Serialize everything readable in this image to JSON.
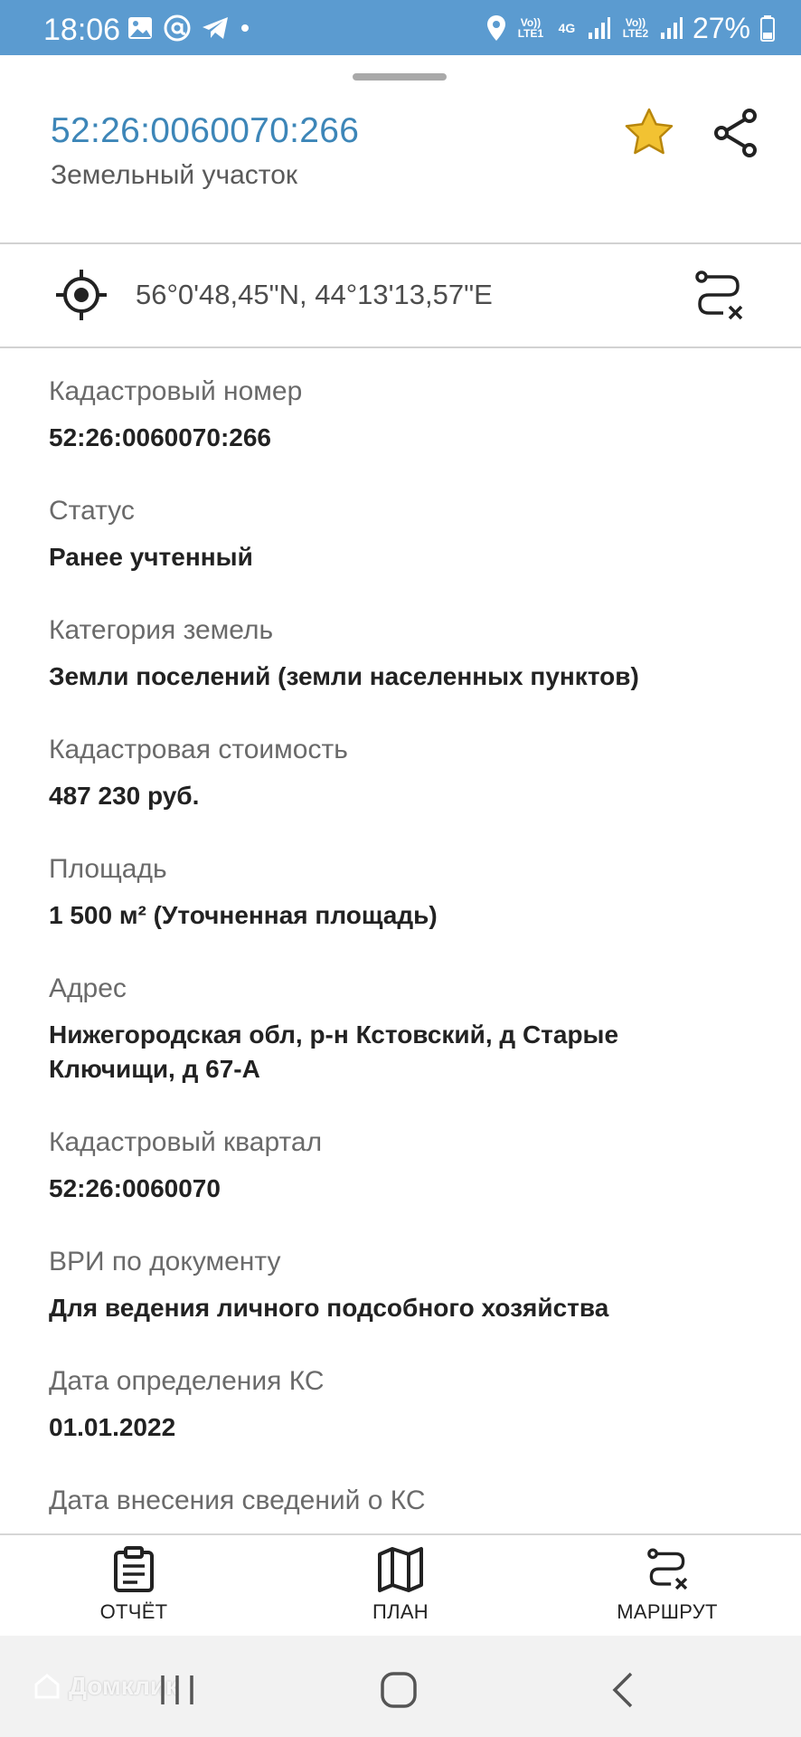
{
  "status_bar": {
    "time": "18:06",
    "net1_label": "Vo)) LTE1",
    "net_type": "4G",
    "net2_label": "Vo)) LTE2",
    "battery": "27%"
  },
  "header": {
    "title": "52:26:0060070:266",
    "subtitle": "Земельный участок"
  },
  "coords": {
    "text": "56°0'48,45\"N, 44°13'13,57\"E"
  },
  "properties": [
    {
      "label": "Кадастровый номер",
      "value": "52:26:0060070:266"
    },
    {
      "label": "Статус",
      "value": "Ранее учтенный"
    },
    {
      "label": "Категория земель",
      "value": "Земли поселений (земли населенных пунктов)"
    },
    {
      "label": "Кадастровая стоимость",
      "value": "487 230 руб."
    },
    {
      "label": "Площадь",
      "value": "1 500 м² (Уточненная площадь)"
    },
    {
      "label": "Адрес",
      "value": "Нижегородская обл, р-н Кстовский, д Старые Ключищи, д 67-А"
    },
    {
      "label": "Кадастровый квартал",
      "value": "52:26:0060070"
    },
    {
      "label": "ВРИ по документу",
      "value": "Для ведения личного подсобного хозяйства"
    },
    {
      "label": "Дата определения КС",
      "value": "01.01.2022"
    },
    {
      "label": "Дата внесения сведений о КС",
      "value": ""
    }
  ],
  "bottom_nav": {
    "report_label": "ОТЧЁТ",
    "plan_label": "ПЛАН",
    "route_label": "МАРШРУТ"
  },
  "watermark": "Домклик",
  "colors": {
    "status_bar": "#5b9bd0",
    "title_link": "#3d86b8",
    "star": "#f2c232"
  },
  "icons": [
    "star-icon",
    "share-icon",
    "target-icon",
    "route-clear-icon",
    "clipboard-icon",
    "map-icon"
  ]
}
